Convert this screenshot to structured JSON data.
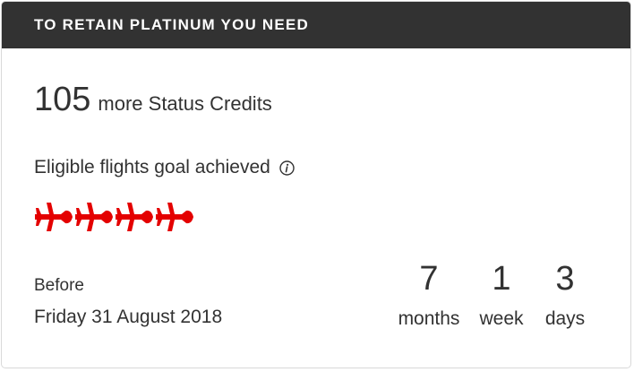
{
  "header": {
    "title": "TO RETAIN PLATINUM YOU NEED"
  },
  "status_credits": {
    "amount": "105",
    "label": "more Status Credits"
  },
  "flights": {
    "label": "Eligible flights goal achieved",
    "info_icon": "info-icon",
    "plane_icon": "plane-icon",
    "plane_count": 4,
    "plane_color": "#e40000"
  },
  "deadline": {
    "before_label": "Before",
    "date": "Friday 31 August 2018"
  },
  "countdown": {
    "months_value": "7",
    "months_label": "months",
    "weeks_value": "1",
    "weeks_label": "week",
    "days_value": "3",
    "days_label": "days"
  },
  "colors": {
    "header_bg": "#323232",
    "header_text": "#ffffff",
    "text": "#323232",
    "accent_red": "#e40000"
  }
}
